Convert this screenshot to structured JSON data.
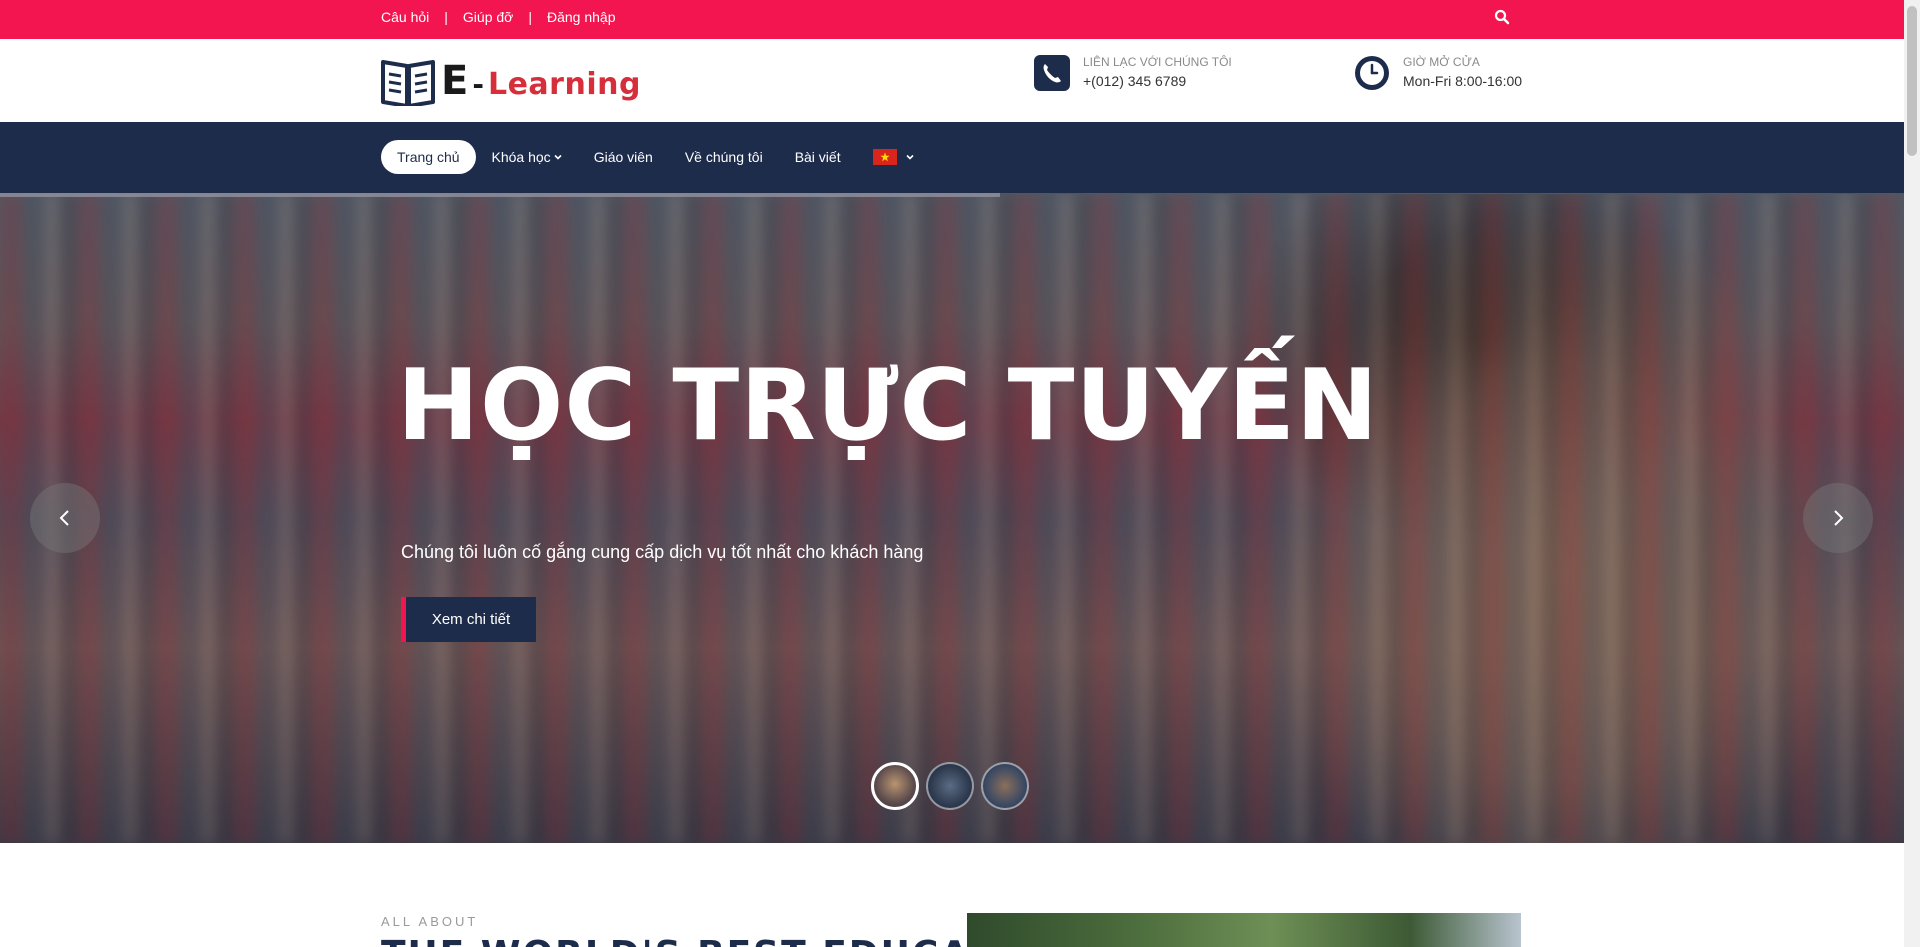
{
  "topbar": {
    "links": [
      "Câu hỏi",
      "Giúp đỡ",
      "Đăng nhập"
    ],
    "separator": "|"
  },
  "header": {
    "logo": {
      "e": "E",
      "dash": "-",
      "learning": "Learning"
    },
    "contact": {
      "label": "LIÊN LẠC VỚI CHÚNG TÔI",
      "value": "+(012) 345 6789"
    },
    "hours": {
      "label": "GIỜ MỞ CỬA",
      "value": "Mon-Fri 8:00-16:00"
    }
  },
  "nav": {
    "items": [
      {
        "label": "Trang chủ",
        "active": true
      },
      {
        "label": "Khóa học",
        "dropdown": true
      },
      {
        "label": "Giáo viên"
      },
      {
        "label": "Về chúng tôi"
      },
      {
        "label": "Bài viết"
      }
    ],
    "language": "vi"
  },
  "hero": {
    "title": "HỌC TRỰC TUYẾN",
    "subtitle": "Chúng tôi luôn cố gắng cung cấp dịch vụ tốt nhất cho khách hàng",
    "button": "Xem chi tiết",
    "active_slide": 1,
    "slide_count": 3
  },
  "about": {
    "eyebrow": "ALL ABOUT",
    "heading": "THE WORLD'S BEST EDUCATION IN"
  },
  "colors": {
    "topbar": "#f2154f",
    "nav": "#1e2c4c",
    "accent_red": "#d62e3a"
  }
}
